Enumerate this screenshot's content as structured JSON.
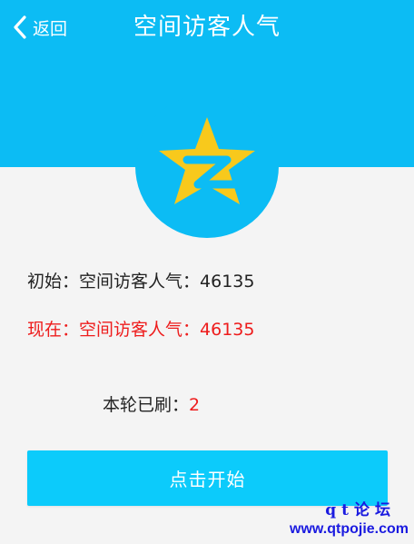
{
  "header": {
    "back_label": "返回",
    "title": "空间访客人气"
  },
  "logo": {
    "icon": "qzone-star-icon",
    "color": "#f8c91c"
  },
  "stats": {
    "initial_label": "初始：空间访客人气：",
    "initial_value": "46135",
    "current_label": "现在：空间访客人气：",
    "current_value": "46135",
    "round_label": "本轮已刷：",
    "round_value": "2"
  },
  "actions": {
    "start_label": "点击开始"
  },
  "watermark": {
    "line1": "qt论坛",
    "line2": "www.qtpojie.com"
  },
  "colors": {
    "header": "#0cbcf4",
    "button": "#0ccbfb",
    "highlight": "#ee1c1c",
    "watermark": "#1a1ae0"
  }
}
